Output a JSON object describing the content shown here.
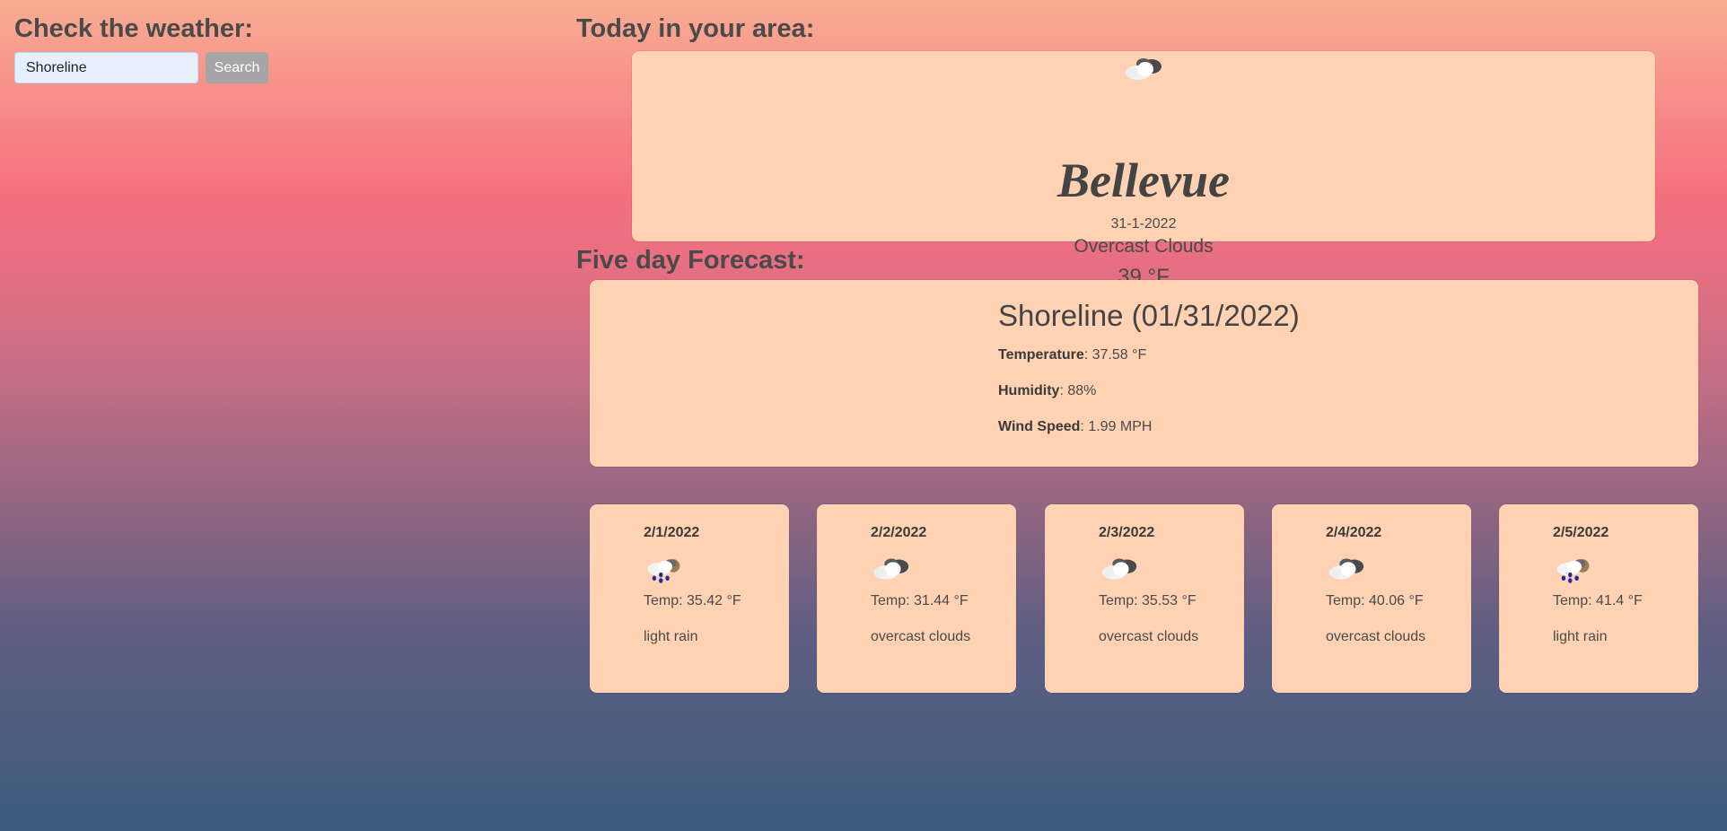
{
  "search_panel": {
    "heading": "Check the weather:",
    "input_value": "Shoreline",
    "button_label": "Search"
  },
  "today": {
    "heading": "Today in your area:",
    "icon": "overcast-clouds-icon",
    "city": "Bellevue",
    "date": "31-1-2022",
    "description": "Overcast Clouds",
    "temperature": "39 °F"
  },
  "forecast": {
    "heading": "Five day Forecast:",
    "current": {
      "title": "Shoreline (01/31/2022)",
      "temperature_label": "Temperature",
      "temperature_value": ": 37.58 °F",
      "humidity_label": "Humidity",
      "humidity_value": ": 88%",
      "wind_label": "Wind Speed",
      "wind_value": ": 1.99 MPH"
    },
    "days": [
      {
        "date": "2/1/2022",
        "icon": "light-rain-icon",
        "temp": "Temp: 35.42 °F",
        "description": "light rain"
      },
      {
        "date": "2/2/2022",
        "icon": "overcast-clouds-icon",
        "temp": "Temp: 31.44 °F",
        "description": "overcast clouds"
      },
      {
        "date": "2/3/2022",
        "icon": "overcast-clouds-icon",
        "temp": "Temp: 35.53 °F",
        "description": "overcast clouds"
      },
      {
        "date": "2/4/2022",
        "icon": "overcast-clouds-icon",
        "temp": "Temp: 40.06 °F",
        "description": "overcast clouds"
      },
      {
        "date": "2/5/2022",
        "icon": "light-rain-icon",
        "temp": "Temp: 41.4 °F",
        "description": "light rain"
      }
    ]
  }
}
